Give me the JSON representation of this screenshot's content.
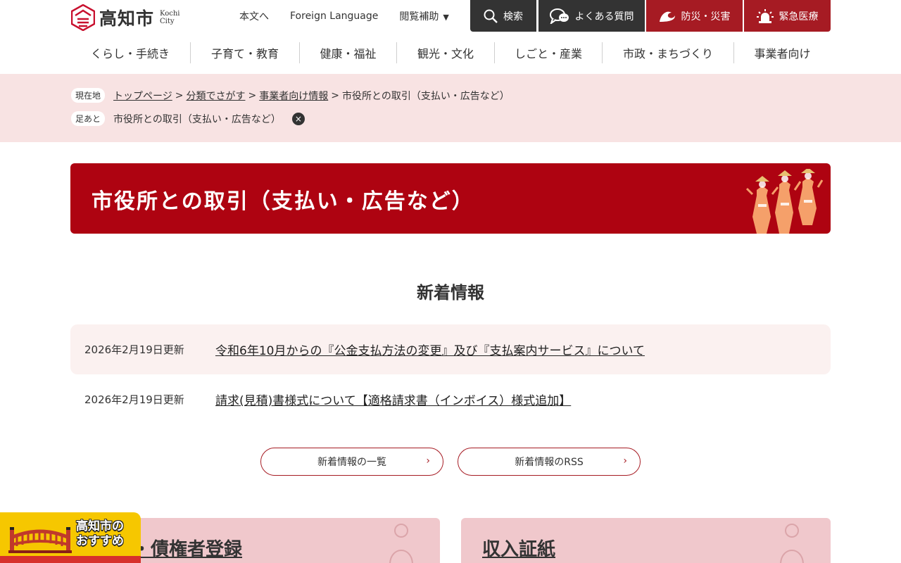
{
  "header": {
    "logo_name": "高知市",
    "logo_en_1": "Kochi",
    "logo_en_2": "City",
    "links": {
      "main_content": "本文へ",
      "foreign": "Foreign Language",
      "browse_assist": "閲覧補助",
      "browse_assist_arrow": "▼"
    },
    "buttons": {
      "search": "検索",
      "faq": "よくある質問",
      "disaster": "防災・災害",
      "emergency": "緊急医療"
    }
  },
  "gnav": [
    "くらし・手続き",
    "子育て・教育",
    "健康・福祉",
    "観光・文化",
    "しごと・産業",
    "市政・まちづくり",
    "事業者向け"
  ],
  "breadcrumb": {
    "current_tag": "現在地",
    "items": [
      "トップページ",
      "分類でさがす",
      "事業者向け情報"
    ],
    "current": "市役所との取引（支払い・広告など）",
    "sep": ">",
    "history_tag": "足あと",
    "history_item": "市役所との取引（支払い・広告など）",
    "close_glyph": "×"
  },
  "page_title": "市役所との取引（支払い・広告など）",
  "news": {
    "heading": "新着情報",
    "items": [
      {
        "date": "2026年2月19日更新",
        "title": "令和6年10月からの『公金支払方法の変更』及び『支払案内サービス』について"
      },
      {
        "date": "2026年2月19日更新",
        "title": "請求(見積)書様式について【適格請求書（インボイス）様式追加】"
      }
    ],
    "list_button": "新着情報の一覧",
    "rss_button": "新着情報のRSS",
    "chevron": "›"
  },
  "cards": {
    "left_title": "書・債権者登録",
    "right_title": "収入証紙"
  },
  "recommend": {
    "line1": "高知市の",
    "line2": "おすすめ"
  },
  "colors": {
    "brand_red": "#ae0311",
    "dark": "#333333",
    "band_pink": "#f8e3e3",
    "card_pink": "#f0c8cc",
    "recommend_yellow": "#f6c700"
  }
}
